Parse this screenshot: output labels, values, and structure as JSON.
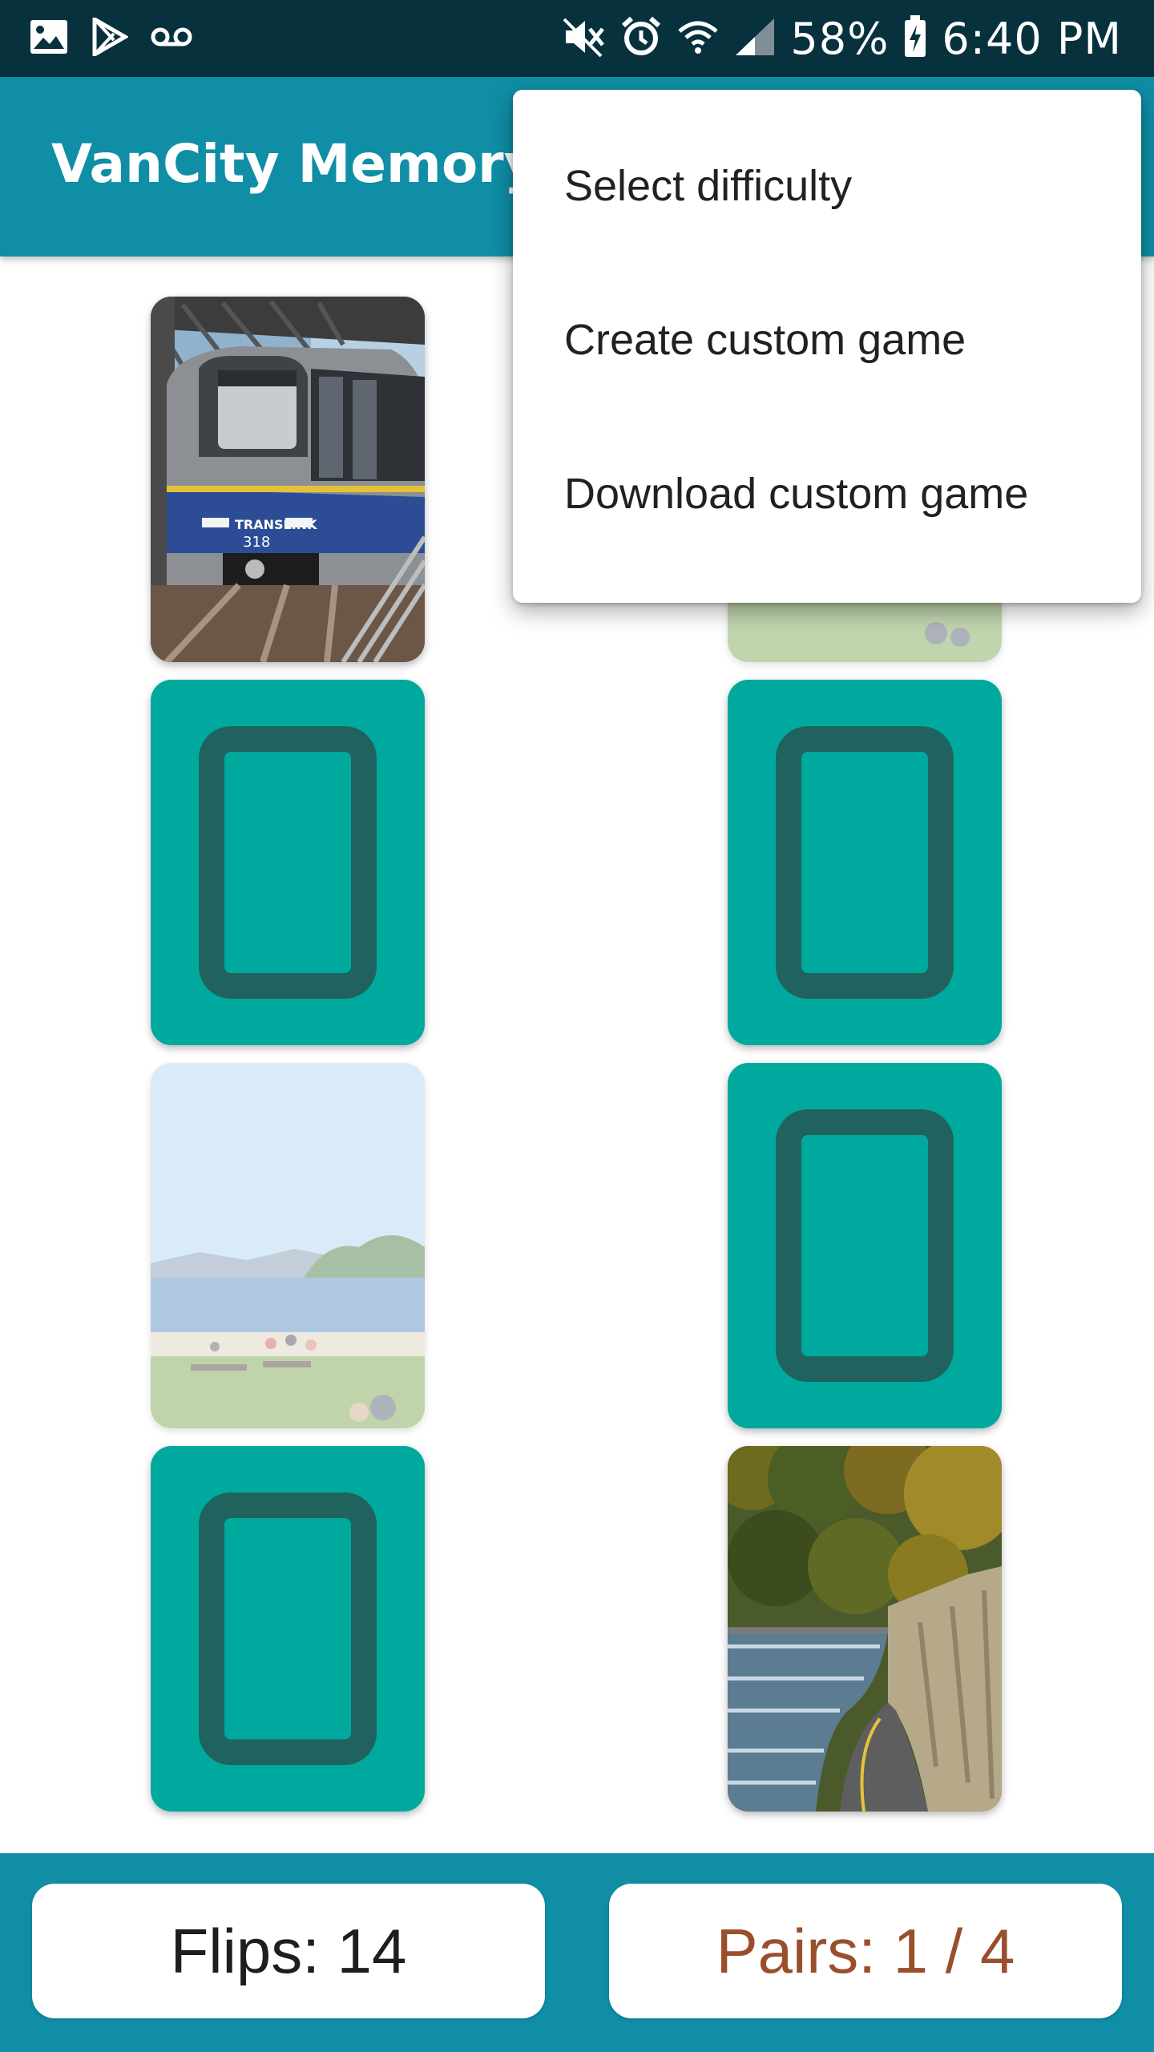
{
  "status_bar": {
    "icons_left": [
      "gallery-icon",
      "play-store-icon",
      "voicemail-icon"
    ],
    "icons_right": [
      "mute-icon",
      "alarm-icon",
      "wifi-icon",
      "signal-icon"
    ],
    "battery": "58%",
    "battery_icon": "battery-charging-icon",
    "time": "6:40 PM"
  },
  "app_bar": {
    "title": "VanCity Memory Match",
    "bg_color": "#0f8ea6"
  },
  "board": {
    "card_back_color": "#00a99d",
    "card_back_frame_color": "#20635e",
    "cards": [
      {
        "state": "face-up",
        "image": "skytrain-photo"
      },
      {
        "state": "face-up-matched",
        "image": "beach-photo"
      },
      {
        "state": "face-down"
      },
      {
        "state": "face-down"
      },
      {
        "state": "face-up-matched",
        "image": "beach-photo"
      },
      {
        "state": "face-down"
      },
      {
        "state": "face-down"
      },
      {
        "state": "face-up",
        "image": "seawall-photo"
      }
    ],
    "skytrain_number": "318",
    "skytrain_logo": "TRANSLINK"
  },
  "bottom_bar": {
    "flips_label": "Flips: 14",
    "pairs_label": "Pairs: 1 / 4",
    "pairs_color": "#9a4f2c"
  },
  "menu": {
    "items": [
      {
        "label": "Select difficulty"
      },
      {
        "label": "Create custom game"
      },
      {
        "label": "Download custom game"
      }
    ]
  }
}
